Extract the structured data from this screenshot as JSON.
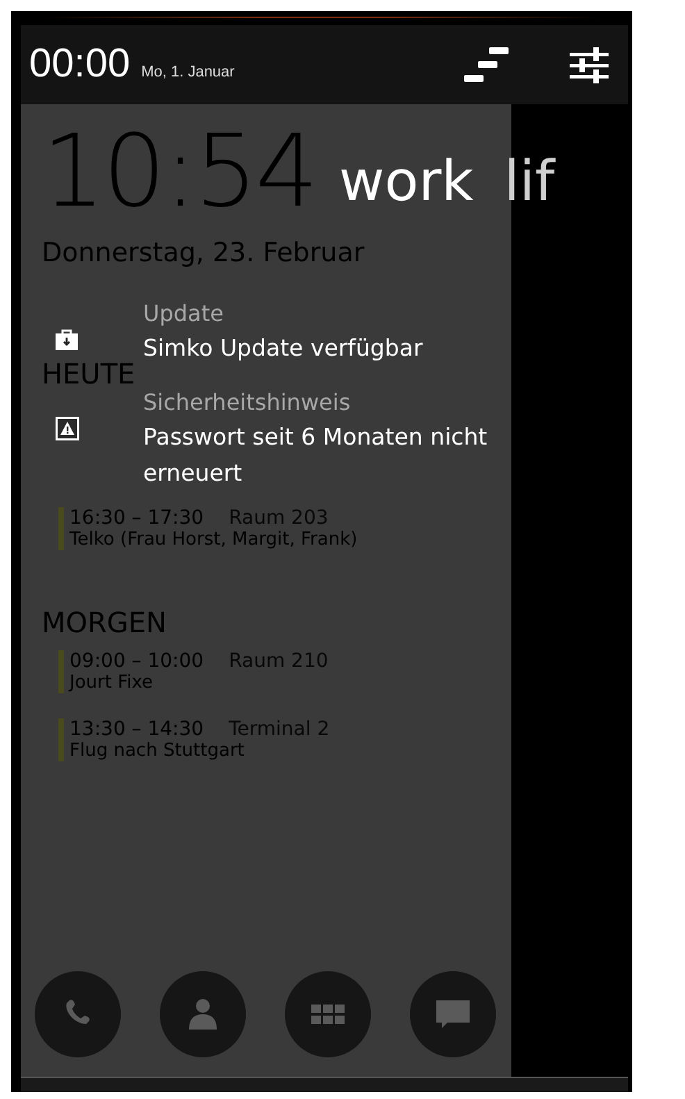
{
  "status_bar": {
    "time": "00:00",
    "date": "Mo, 1. Januar"
  },
  "tabs": [
    {
      "label": "work",
      "selected": true
    },
    {
      "label": "lif",
      "selected": false
    }
  ],
  "clock": {
    "time": "10:54",
    "date": "Donnerstag, 23. Februar"
  },
  "notifications": [
    {
      "kind": "update",
      "title": "Update",
      "message": "Simko Update verfügbar"
    },
    {
      "kind": "warning",
      "title": "Sicherheitshinweis",
      "message": "Passwort seit 6 Monaten nicht erneuert"
    }
  ],
  "agenda": [
    {
      "heading": "HEUTE",
      "events": [
        {
          "time": "16:30 – 17:30",
          "location": "Raum 203",
          "title": "Telko (Frau Horst, Margit, Frank)",
          "color": "#4a4a1c"
        }
      ]
    },
    {
      "heading": "MORGEN",
      "events": [
        {
          "time": "09:00 – 10:00",
          "location": "Raum 210",
          "title": "Jourt Fixe",
          "color": "#4a4a1c"
        },
        {
          "time": "13:30 – 14:30",
          "location": "Terminal 2",
          "title": "Flug nach Stuttgart",
          "color": "#4a4a1c"
        }
      ]
    }
  ],
  "dock": [
    {
      "kind": "phone"
    },
    {
      "kind": "contact"
    },
    {
      "kind": "apps"
    },
    {
      "kind": "messages"
    }
  ]
}
